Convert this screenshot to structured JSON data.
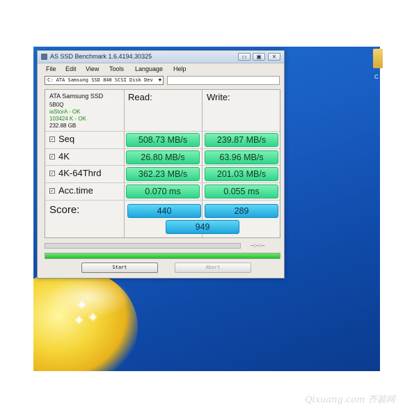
{
  "window": {
    "title": "AS SSD Benchmark 1.6.4194.30325",
    "controls": {
      "minimize": "▭",
      "maximize": "▣",
      "close": "✕"
    }
  },
  "menu": [
    "File",
    "Edit",
    "View",
    "Tools",
    "Language",
    "Help"
  ],
  "drive_select": {
    "value": "C: ATA Samsung SSD 840 SCSI Disk Dev"
  },
  "device_info": {
    "name": "ATA Samsung SSD",
    "firmware": "5B0Q",
    "driver": "iaStorA - OK",
    "alignment": "103424 K - OK",
    "capacity": "232.88 GB"
  },
  "columns": {
    "read": "Read:",
    "write": "Write:"
  },
  "tests": [
    {
      "label": "Seq",
      "checked": true,
      "read": "508.73 MB/s",
      "write": "239.87 MB/s"
    },
    {
      "label": "4K",
      "checked": true,
      "read": "26.80 MB/s",
      "write": "63.96 MB/s"
    },
    {
      "label": "4K-64Thrd",
      "checked": true,
      "read": "362.23 MB/s",
      "write": "201.03 MB/s"
    },
    {
      "label": "Acc.time",
      "checked": true,
      "read": "0.070 ms",
      "write": "0.055 ms"
    }
  ],
  "score": {
    "label": "Score:",
    "read": "440",
    "write": "289",
    "total": "949"
  },
  "progress": {
    "time": "--:--:--",
    "total_fraction": 1.0
  },
  "buttons": {
    "start": "Start",
    "abort": "Abort"
  },
  "desktop": {
    "folder_label": "C"
  },
  "watermark": "Qixuang.com 齐装网",
  "colors": {
    "result_green": "#2fd58a",
    "score_blue": "#1ea6dd",
    "ok_text": "#1a8f1a",
    "desktop_blue": "#1a5fc4"
  }
}
